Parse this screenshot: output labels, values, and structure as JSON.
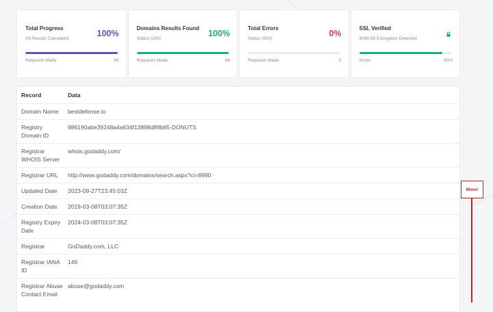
{
  "cards": [
    {
      "title": "Total Progress",
      "sub": "All Results Calculated",
      "pct": "100%",
      "pct_color": "#5b55b8",
      "fill": 1.0,
      "fill_color": "#5b55b8",
      "foot_label": "Requests Made",
      "foot_value": "66"
    },
    {
      "title": "Domains Results Found",
      "sub": "Status (200)",
      "pct": "100%",
      "pct_color": "#1aa985",
      "fill": 1.0,
      "fill_color": "#1aa985",
      "foot_label": "Requests Made",
      "foot_value": "66"
    },
    {
      "title": "Total Errors",
      "sub": "Status (500)",
      "pct": "0%",
      "pct_color": "#e0365b",
      "fill": 0.0,
      "fill_color": "#e0365b",
      "foot_label": "Requests Made",
      "foot_value": "0"
    },
    {
      "title": "SSL Verified",
      "sub": "4086 Bit Encryption Detected",
      "icon": "lock-icon",
      "icon_color": "#1aa985",
      "fill": 0.9,
      "fill_color": "#1aa985",
      "foot_label": "Score",
      "foot_value": "90%"
    }
  ],
  "table": {
    "headers": [
      "Record",
      "Data"
    ],
    "rows": [
      {
        "record": "Domain Name",
        "data": "bestdefense.io"
      },
      {
        "record": "Registry Domain ID",
        "data": "986190abe39248a4a634f13898d89b65-DONUTS"
      },
      {
        "record": "Registrar WHOIS Server",
        "data": "whois.godaddy.com/"
      },
      {
        "record": "Registrar URL",
        "data": "http://www.godaddy.com/domains/search.aspx?ci=8990"
      },
      {
        "record": "Updated Date",
        "data": "2023-09-27T23:45:03Z"
      },
      {
        "record": "Creation Date",
        "data": "2019-03-08T03:07:35Z"
      },
      {
        "record": "Registry Expiry Date",
        "data": "2024-03-08T03:07:35Z"
      },
      {
        "record": "Registrar",
        "data": "GoDaddy.com, LLC"
      },
      {
        "record": "Registrar IANA ID",
        "data": "146"
      },
      {
        "record": "Registrar Abuse Contact Email",
        "data": "abuse@godaddy.com"
      }
    ]
  },
  "annotation": {
    "label": "More!",
    "color": "#b91d22"
  }
}
